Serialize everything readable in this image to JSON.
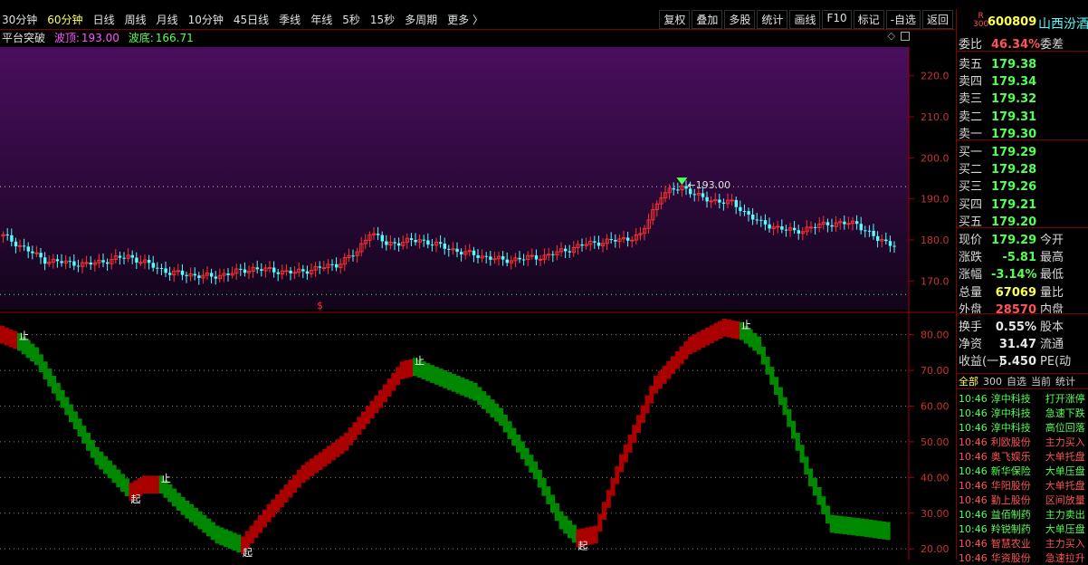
{
  "toolbar": {
    "periods": [
      "30分钟",
      "60分钟",
      "日线",
      "周线",
      "月线",
      "10分钟",
      "45日线",
      "季线",
      "年线",
      "5秒",
      "15秒",
      "多周期",
      "更多 〉"
    ],
    "active_period": 1,
    "tools": [
      "复权",
      "叠加",
      "多股",
      "统计",
      "画线",
      "F10",
      "标记",
      "-自选",
      "返回"
    ]
  },
  "indicator_bar": {
    "name": "平台突破",
    "top_label": "波顶:",
    "top_value": "193.00",
    "bottom_label": "波底:",
    "bottom_value": "166.71"
  },
  "price_chart": {
    "y_ticks": [
      "220.0",
      "210.0",
      "200.0",
      "190.0",
      "180.0",
      "170.0"
    ],
    "y_min": 163,
    "y_max": 227,
    "peak_label": "193.00",
    "peak_value": 193.0,
    "top_line": 193.0,
    "bottom_line": 166.71,
    "marker_symbol": "$",
    "candle_count": 123,
    "up_color": "#ff3232",
    "down_color": "#54ffff",
    "bg_top_color": "#4a0e5e",
    "bg_bottom_color": "#12041a"
  },
  "osc_chart": {
    "y_ticks": [
      "80.00",
      "70.00",
      "60.00",
      "50.00",
      "40.00",
      "30.00",
      "20.00"
    ],
    "y_min": 17,
    "y_max": 86,
    "signals": [
      {
        "text": "止",
        "i": 4
      },
      {
        "text": "起",
        "i": 30
      },
      {
        "text": "止",
        "i": 37
      },
      {
        "text": "起",
        "i": 56
      },
      {
        "text": "止",
        "i": 96
      },
      {
        "text": "起",
        "i": 134
      },
      {
        "text": "止",
        "i": 172
      }
    ],
    "red_color": "#aa0000",
    "green_color": "#008800"
  },
  "stock": {
    "code": "600809",
    "name": "山西汾酒",
    "badge_top": "R",
    "badge_bottom": "300",
    "weibi_label": "委比",
    "weibi_value": "46.34%",
    "weicha_label": "委差",
    "asks": [
      {
        "label": "卖五",
        "price": "179.38"
      },
      {
        "label": "卖四",
        "price": "179.34"
      },
      {
        "label": "卖三",
        "price": "179.32"
      },
      {
        "label": "卖二",
        "price": "179.31"
      },
      {
        "label": "卖一",
        "price": "179.30"
      }
    ],
    "bids": [
      {
        "label": "买一",
        "price": "179.29"
      },
      {
        "label": "买二",
        "price": "179.28"
      },
      {
        "label": "买三",
        "price": "179.26"
      },
      {
        "label": "买四",
        "price": "179.21"
      },
      {
        "label": "买五",
        "price": "179.20"
      }
    ],
    "stats": [
      {
        "label": "现价",
        "value": "179.29",
        "extra": "今开",
        "color": "#54ff54"
      },
      {
        "label": "涨跌",
        "value": "-5.81",
        "extra": "最高",
        "color": "#54ff54"
      },
      {
        "label": "涨幅",
        "value": "-3.14%",
        "extra": "最低",
        "color": "#54ff54"
      },
      {
        "label": "总量",
        "value": "67069",
        "extra": "量比",
        "color": "#ffff54"
      },
      {
        "label": "外盘",
        "value": "28570",
        "extra": "内盘",
        "color": "#ff5454"
      },
      {
        "label": "换手",
        "value": "0.55%",
        "extra": "股本",
        "color": "#e8e8e8"
      },
      {
        "label": "净资",
        "value": "31.47",
        "extra": "流通",
        "color": "#e8e8e8"
      },
      {
        "label": "收益(一)",
        "value": "5.450",
        "extra": "PE(动",
        "color": "#e8e8e8"
      }
    ]
  },
  "news_tabs": [
    "全部",
    "300",
    "自选",
    "当前",
    "统计"
  ],
  "news": [
    {
      "time": "10:46",
      "name": "淳中科技",
      "event": "打开涨停",
      "color": "#54ff54"
    },
    {
      "time": "10:46",
      "name": "淳中科技",
      "event": "急速下跌",
      "color": "#54ff54"
    },
    {
      "time": "10:46",
      "name": "淳中科技",
      "event": "高位回落",
      "color": "#54ff54"
    },
    {
      "time": "10:46",
      "name": "利欧股份",
      "event": "主力买入",
      "color": "#ff5454"
    },
    {
      "time": "10:46",
      "name": "奥飞娱乐",
      "event": "大单托盘",
      "color": "#ff5454"
    },
    {
      "time": "10:46",
      "name": "新华保险",
      "event": "大单压盘",
      "color": "#54ff54"
    },
    {
      "time": "10:46",
      "name": "华阳股份",
      "event": "大单托盘",
      "color": "#ff5454"
    },
    {
      "time": "10:46",
      "name": "勤上股份",
      "event": "区间放量",
      "color": "#ff5454"
    },
    {
      "time": "10:46",
      "name": "益佰制药",
      "event": "主力卖出",
      "color": "#54ff54"
    },
    {
      "time": "10:46",
      "name": "羚锐制药",
      "event": "大单压盘",
      "color": "#54ff54"
    },
    {
      "time": "10:46",
      "name": "智慧农业",
      "event": "主力买入",
      "color": "#ff5454"
    },
    {
      "time": "10:46",
      "name": "华资股份",
      "event": "急速拉升",
      "color": "#ff5454"
    }
  ]
}
